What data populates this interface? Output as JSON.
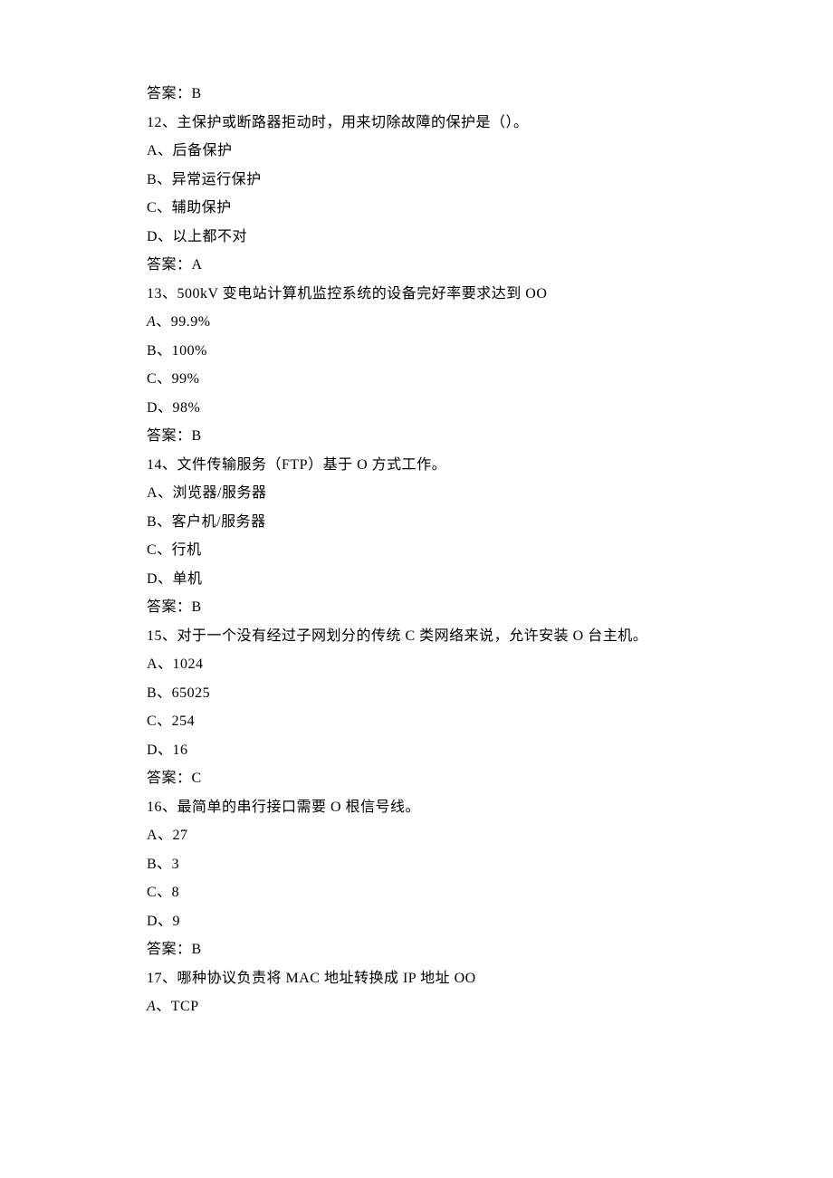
{
  "lines": [
    "答案：B",
    "12、主保护或断路器拒动时，用来切除故障的保护是（）。",
    "A、后备保护",
    "B、异常运行保护",
    "C、辅助保护",
    "D、以上都不对",
    "答案：A",
    "13、500kV 变电站计算机监控系统的设备完好率要求达到 OO",
    "A、99.9%",
    "B、100%",
    "C、99%",
    "D、98%",
    "答案：B",
    "14、文件传输服务（FTP）基于 O 方式工作。",
    "A、浏览器/服务器",
    "B、客户机/服务器",
    "C、行机",
    "D、单机",
    "答案：B",
    "15、对于一个没有经过子网划分的传统 C 类网络来说，允许安装 O 台主机。",
    "A、1024",
    "B、65025",
    "C、254",
    "D、16",
    "答案：C",
    "16、最简单的串行接口需要 O 根信号线。",
    "A、27",
    "B、3",
    "C、8",
    "D、9",
    "答案：B",
    "17、哪种协议负责将 MAC 地址转换成 IP 地址 OO",
    "A、TCP"
  ],
  "italicLines": [
    8,
    32
  ]
}
